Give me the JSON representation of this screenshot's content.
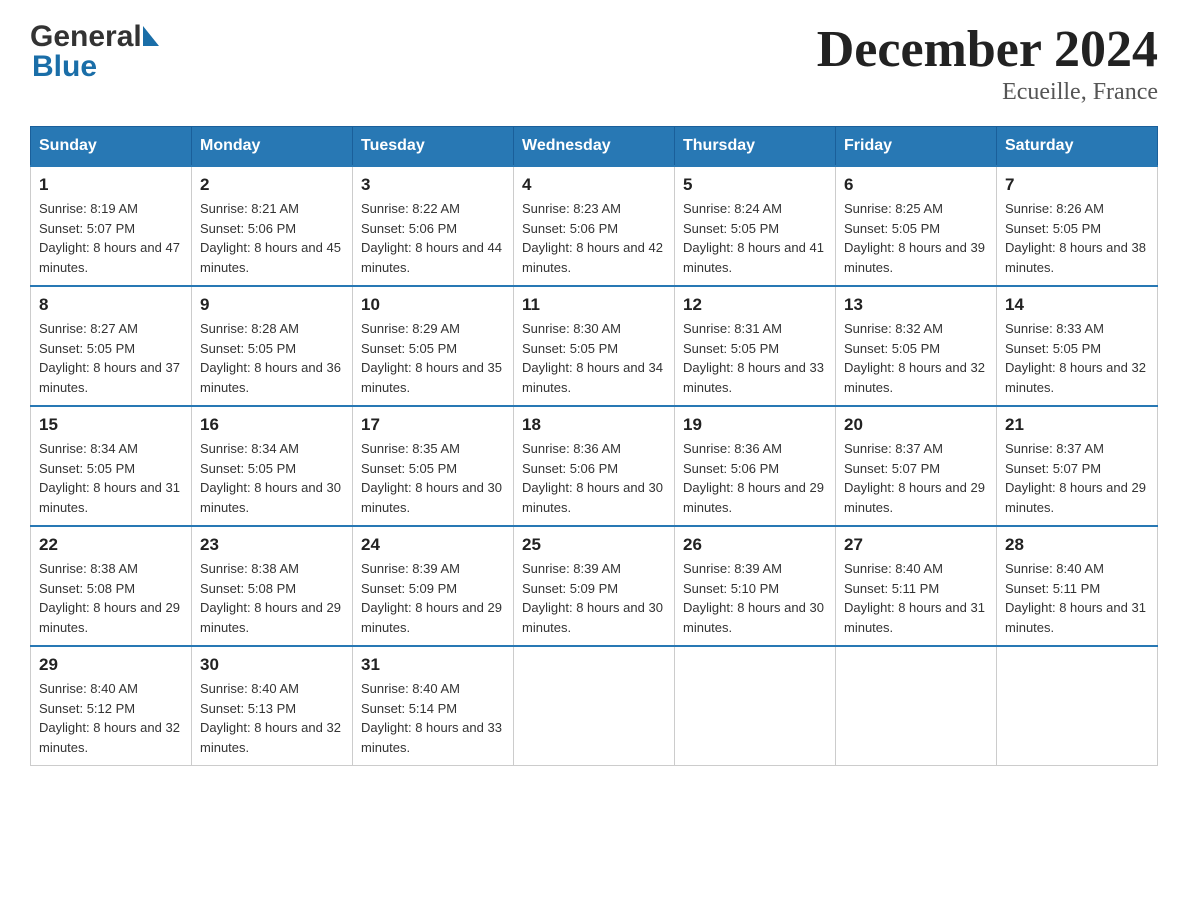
{
  "header": {
    "title": "December 2024",
    "subtitle": "Ecueille, France"
  },
  "logo": {
    "line1": "General",
    "line2": "Blue"
  },
  "days_of_week": [
    "Sunday",
    "Monday",
    "Tuesday",
    "Wednesday",
    "Thursday",
    "Friday",
    "Saturday"
  ],
  "weeks": [
    [
      {
        "day": "1",
        "sunrise": "8:19 AM",
        "sunset": "5:07 PM",
        "daylight": "8 hours and 47 minutes."
      },
      {
        "day": "2",
        "sunrise": "8:21 AM",
        "sunset": "5:06 PM",
        "daylight": "8 hours and 45 minutes."
      },
      {
        "day": "3",
        "sunrise": "8:22 AM",
        "sunset": "5:06 PM",
        "daylight": "8 hours and 44 minutes."
      },
      {
        "day": "4",
        "sunrise": "8:23 AM",
        "sunset": "5:06 PM",
        "daylight": "8 hours and 42 minutes."
      },
      {
        "day": "5",
        "sunrise": "8:24 AM",
        "sunset": "5:05 PM",
        "daylight": "8 hours and 41 minutes."
      },
      {
        "day": "6",
        "sunrise": "8:25 AM",
        "sunset": "5:05 PM",
        "daylight": "8 hours and 39 minutes."
      },
      {
        "day": "7",
        "sunrise": "8:26 AM",
        "sunset": "5:05 PM",
        "daylight": "8 hours and 38 minutes."
      }
    ],
    [
      {
        "day": "8",
        "sunrise": "8:27 AM",
        "sunset": "5:05 PM",
        "daylight": "8 hours and 37 minutes."
      },
      {
        "day": "9",
        "sunrise": "8:28 AM",
        "sunset": "5:05 PM",
        "daylight": "8 hours and 36 minutes."
      },
      {
        "day": "10",
        "sunrise": "8:29 AM",
        "sunset": "5:05 PM",
        "daylight": "8 hours and 35 minutes."
      },
      {
        "day": "11",
        "sunrise": "8:30 AM",
        "sunset": "5:05 PM",
        "daylight": "8 hours and 34 minutes."
      },
      {
        "day": "12",
        "sunrise": "8:31 AM",
        "sunset": "5:05 PM",
        "daylight": "8 hours and 33 minutes."
      },
      {
        "day": "13",
        "sunrise": "8:32 AM",
        "sunset": "5:05 PM",
        "daylight": "8 hours and 32 minutes."
      },
      {
        "day": "14",
        "sunrise": "8:33 AM",
        "sunset": "5:05 PM",
        "daylight": "8 hours and 32 minutes."
      }
    ],
    [
      {
        "day": "15",
        "sunrise": "8:34 AM",
        "sunset": "5:05 PM",
        "daylight": "8 hours and 31 minutes."
      },
      {
        "day": "16",
        "sunrise": "8:34 AM",
        "sunset": "5:05 PM",
        "daylight": "8 hours and 30 minutes."
      },
      {
        "day": "17",
        "sunrise": "8:35 AM",
        "sunset": "5:05 PM",
        "daylight": "8 hours and 30 minutes."
      },
      {
        "day": "18",
        "sunrise": "8:36 AM",
        "sunset": "5:06 PM",
        "daylight": "8 hours and 30 minutes."
      },
      {
        "day": "19",
        "sunrise": "8:36 AM",
        "sunset": "5:06 PM",
        "daylight": "8 hours and 29 minutes."
      },
      {
        "day": "20",
        "sunrise": "8:37 AM",
        "sunset": "5:07 PM",
        "daylight": "8 hours and 29 minutes."
      },
      {
        "day": "21",
        "sunrise": "8:37 AM",
        "sunset": "5:07 PM",
        "daylight": "8 hours and 29 minutes."
      }
    ],
    [
      {
        "day": "22",
        "sunrise": "8:38 AM",
        "sunset": "5:08 PM",
        "daylight": "8 hours and 29 minutes."
      },
      {
        "day": "23",
        "sunrise": "8:38 AM",
        "sunset": "5:08 PM",
        "daylight": "8 hours and 29 minutes."
      },
      {
        "day": "24",
        "sunrise": "8:39 AM",
        "sunset": "5:09 PM",
        "daylight": "8 hours and 29 minutes."
      },
      {
        "day": "25",
        "sunrise": "8:39 AM",
        "sunset": "5:09 PM",
        "daylight": "8 hours and 30 minutes."
      },
      {
        "day": "26",
        "sunrise": "8:39 AM",
        "sunset": "5:10 PM",
        "daylight": "8 hours and 30 minutes."
      },
      {
        "day": "27",
        "sunrise": "8:40 AM",
        "sunset": "5:11 PM",
        "daylight": "8 hours and 31 minutes."
      },
      {
        "day": "28",
        "sunrise": "8:40 AM",
        "sunset": "5:11 PM",
        "daylight": "8 hours and 31 minutes."
      }
    ],
    [
      {
        "day": "29",
        "sunrise": "8:40 AM",
        "sunset": "5:12 PM",
        "daylight": "8 hours and 32 minutes."
      },
      {
        "day": "30",
        "sunrise": "8:40 AM",
        "sunset": "5:13 PM",
        "daylight": "8 hours and 32 minutes."
      },
      {
        "day": "31",
        "sunrise": "8:40 AM",
        "sunset": "5:14 PM",
        "daylight": "8 hours and 33 minutes."
      },
      null,
      null,
      null,
      null
    ]
  ],
  "labels": {
    "sunrise": "Sunrise:",
    "sunset": "Sunset:",
    "daylight": "Daylight:"
  }
}
